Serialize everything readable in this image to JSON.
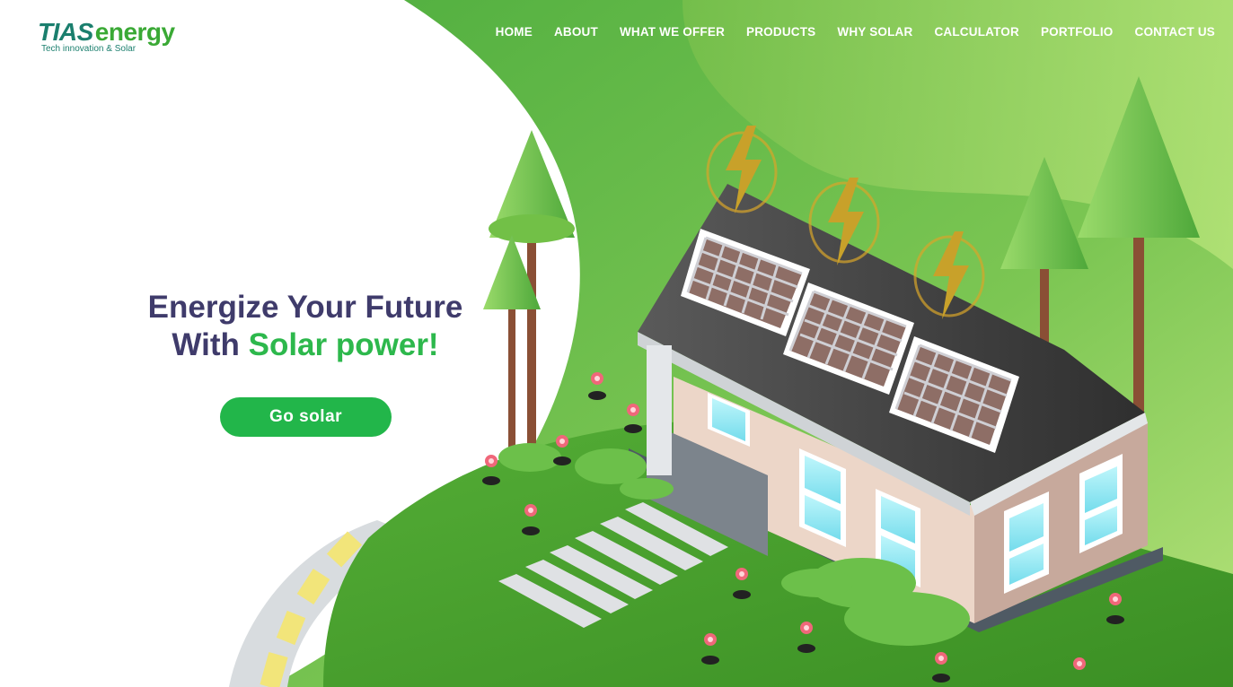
{
  "brand": {
    "name_part1": "TIAS",
    "name_part2": "energy",
    "tagline": "Tech innovation & Solar"
  },
  "nav": {
    "items": [
      {
        "label": "HOME"
      },
      {
        "label": "ABOUT"
      },
      {
        "label": "WHAT WE OFFER"
      },
      {
        "label": "PRODUCTS"
      },
      {
        "label": "WHY SOLAR"
      },
      {
        "label": "CALCULATOR"
      },
      {
        "label": "PORTFOLIO"
      },
      {
        "label": "CONTACT US"
      }
    ]
  },
  "hero": {
    "line1": "Energize Your Future",
    "line2_prefix": "With ",
    "line2_accent": "Solar power!",
    "cta_label": "Go solar"
  },
  "colors": {
    "brand_teal": "#1b7f6e",
    "brand_green": "#3aa935",
    "headline": "#3f3b6b",
    "accent": "#2db84c",
    "button": "#22b64a"
  },
  "illustration": {
    "subject": "house-with-solar-panels",
    "icons": [
      "lightning-icon",
      "tree-icon",
      "flower-icon"
    ]
  }
}
